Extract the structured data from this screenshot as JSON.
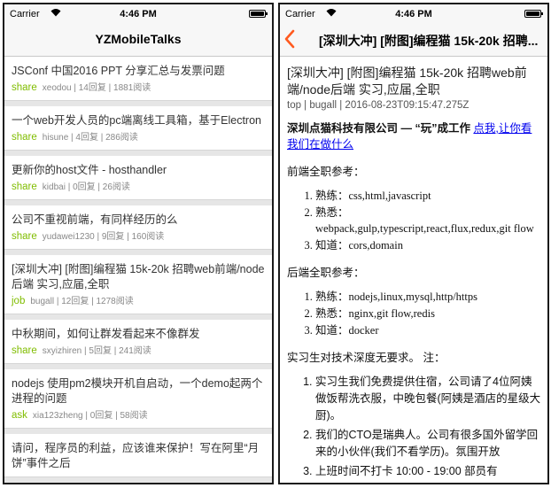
{
  "statusbar": {
    "carrier": "Carrier",
    "time": "4:46 PM",
    "battery_level": 1.0
  },
  "left": {
    "nav_title": "YZMobileTalks",
    "tab_color": "#80bd01",
    "topics": [
      {
        "title": "JSConf 中国2016 PPT 分享汇总与发票问题",
        "tab": "share",
        "meta": "xeodou | 14回复 | 1881阅读"
      },
      {
        "title": "一个web开发人员的pc端离线工具箱，基于Electron",
        "tab": "share",
        "meta": "hisune | 4回复 | 286阅读"
      },
      {
        "title": "更新你的host文件 - hosthandler",
        "tab": "share",
        "meta": "kidbai | 0回复 | 26阅读"
      },
      {
        "title": "公司不重视前端，有同样经历的么",
        "tab": "share",
        "meta": "yudawei1230 | 9回复 | 160阅读"
      },
      {
        "title": "[深圳大冲] [附图]编程猫 15k-20k 招聘web前端/node后端  实习,应届,全职",
        "tab": "job",
        "meta": "bugall | 12回复 | 1278阅读"
      },
      {
        "title": "中秋期间，如何让群发看起来不像群发",
        "tab": "share",
        "meta": "sxyizhiren | 5回复 | 241阅读"
      },
      {
        "title": "nodejs  使用pm2模块开机自启动，一个demo起两个进程的问题",
        "tab": "ask",
        "meta": "xia123zheng | 0回复 | 58阅读"
      },
      {
        "title": "请问，程序员的利益，应该谁来保护！写在阿里“月饼”事件之后",
        "tab": "",
        "meta": ""
      }
    ]
  },
  "right": {
    "nav_title": "[深圳大冲] [附图]编程猫 15k-20k 招聘...",
    "accent": "#ff5a1f",
    "title": "[深圳大冲] [附图]编程猫 15k-20k 招聘web前端/node后端  实习,应届,全职",
    "meta": "top | bugall | 2016-08-23T09:15:47.275Z",
    "headline": "深圳点猫科技有限公司 — “玩”成工作 ",
    "headline_link": "点我,让你看我们在做什么",
    "frontend_heading": "前端全职参考：",
    "frontend_items": [
      "熟练：css,html,javascript",
      "熟悉：webpack,gulp,typescript,react,flux,redux,git flow",
      "知道：cors,domain"
    ],
    "backend_heading": "后端全职参考：",
    "backend_items": [
      "熟练：nodejs,linux,mysql,http/https",
      "熟悉：nginx,git flow,redis",
      "知道：docker"
    ],
    "intern_heading": "实习生对技术深度无要求。 注：",
    "intern_items": [
      "实习生我们免费提供住宿，公司请了4位阿姨做饭帮洗衣服，中晚包餐(阿姨是酒店的星级大厨)。",
      "我们的CTO是瑞典人。公司有很多国外留学回来的小伙伴(我们不看学历)。氛围开放",
      "上班时间不打卡 10:00 - 19:00 部员有"
    ]
  }
}
